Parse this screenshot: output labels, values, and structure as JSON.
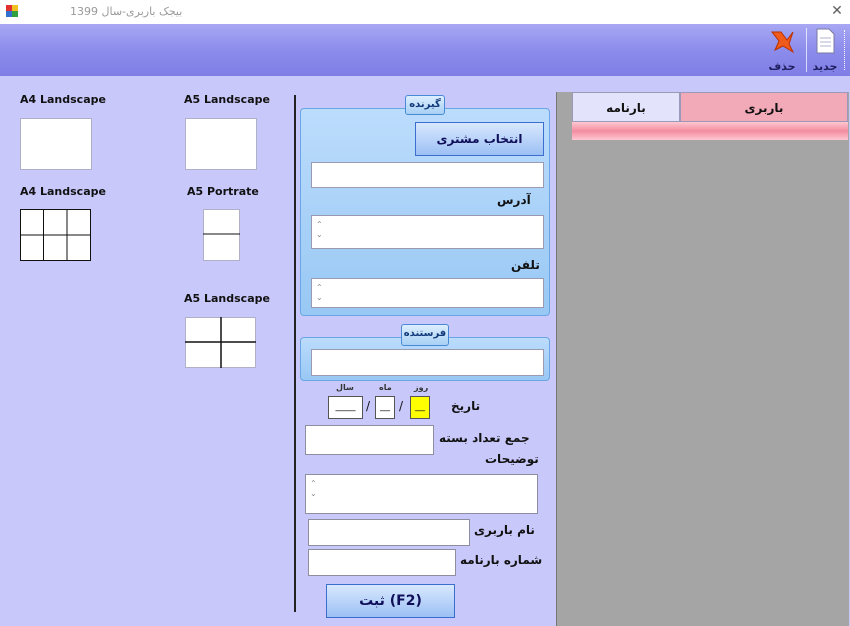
{
  "window": {
    "title": "بیجک باربری-سال 1399",
    "close_glyph": "✕"
  },
  "toolbar": {
    "new_label": "جدید",
    "delete_label": "حذف"
  },
  "grid": {
    "columns": [
      "بارنامه",
      "باربری"
    ]
  },
  "print_layouts": [
    {
      "label": "A4 Landscape"
    },
    {
      "label": "A5 Landscape"
    },
    {
      "label": "A4 Landscape"
    },
    {
      "label": "A5 Portrate"
    },
    {
      "label": "A5 Landscape"
    }
  ],
  "receiver": {
    "legend": "گیرنده",
    "select_customer_label": "انتخاب مشتری",
    "address_label": "آدرس",
    "phone_label": "تلفن"
  },
  "sender": {
    "legend": "فرستنده"
  },
  "date": {
    "label": "تاریخ",
    "day_label": "روز",
    "month_label": "ماه",
    "year_label": "سال",
    "day_value": "__",
    "month_value": "__",
    "year_value": "____",
    "separator": "/"
  },
  "form": {
    "total_packages_label": "جمع تعداد بسته",
    "description_label": "توضیحات",
    "carrier_name_label": "نام باربری",
    "waybill_number_label": "شماره بارنامه",
    "submit_label": "ثبت (F2)"
  },
  "scroll_up_glyph": "⌃",
  "scroll_down_glyph": "⌄",
  "colors": {
    "toolbar": "#8c8cec",
    "workarea": "#c8c8fa",
    "grid_bg": "#a5a5a5",
    "accent_pink": "#f2aab8",
    "group_blue": "#98c8f4"
  }
}
